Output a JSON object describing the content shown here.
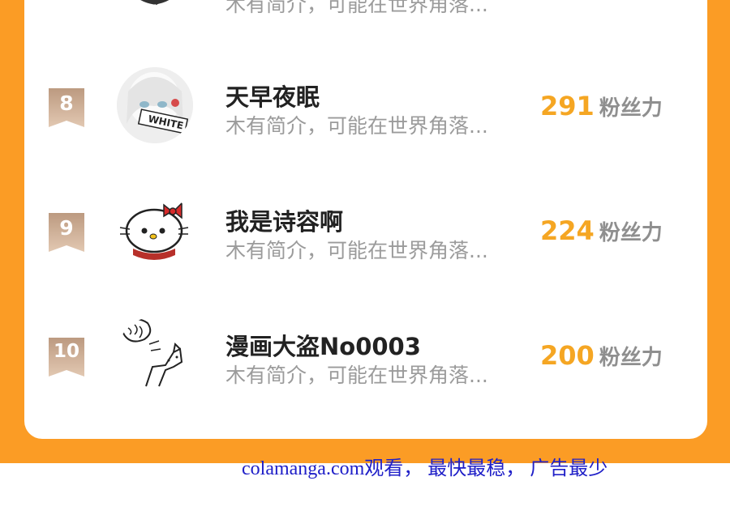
{
  "ranking": {
    "partial_top_row": {
      "bio": "木有简介，可能在世界角落..."
    },
    "rows": [
      {
        "rank": "8",
        "name": "天早夜眠",
        "bio": "木有简介，可能在世界角落...",
        "fans": "291",
        "fans_unit": "粉丝力"
      },
      {
        "rank": "9",
        "name": "我是诗容啊",
        "bio": "木有简介，可能在世界角落...",
        "fans": "224",
        "fans_unit": "粉丝力"
      },
      {
        "rank": "10",
        "name": "漫画大盗No0003",
        "bio": "木有简介，可能在世界角落...",
        "fans": "200",
        "fans_unit": "粉丝力"
      }
    ]
  },
  "footer": {
    "text": "colamanga.com观看， 最快最稳， 广告最少"
  },
  "colors": {
    "accent": "#fb9c25",
    "fans_number": "#f5a623",
    "rank_badge": "#c9a48a",
    "footer_link": "#2020c8"
  }
}
